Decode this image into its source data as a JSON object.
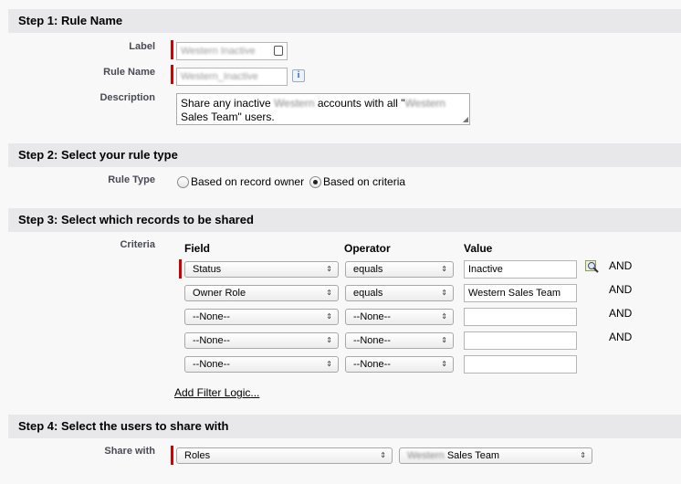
{
  "step1": {
    "header": "Step 1: Rule Name",
    "label_label": "Label",
    "label_value": "Western Inactive",
    "rule_name_label": "Rule Name",
    "rule_name_value": "Western_Inactive",
    "description_label": "Description",
    "description_line1_a": "Share any inactive ",
    "description_line1_blur": "Western",
    "description_line1_b": " accounts with all \"",
    "description_line1_blur2": "Western",
    "description_line2": "Sales Team\" users."
  },
  "step2": {
    "header": "Step 2: Select your rule type",
    "rule_type_label": "Rule Type",
    "option_owner": "Based on record owner",
    "option_criteria": "Based on criteria",
    "selected": "criteria"
  },
  "step3": {
    "header": "Step 3: Select which records to be shared",
    "criteria_label": "Criteria",
    "col_field": "Field",
    "col_operator": "Operator",
    "col_value": "Value",
    "rows": [
      {
        "field": "Status",
        "operator": "equals",
        "value": "Inactive",
        "conj": "AND"
      },
      {
        "field": "Owner Role",
        "operator": "equals",
        "value": "Western Sales Team",
        "conj": "AND"
      },
      {
        "field": "--None--",
        "operator": "--None--",
        "value": "",
        "conj": "AND"
      },
      {
        "field": "--None--",
        "operator": "--None--",
        "value": "",
        "conj": "AND"
      },
      {
        "field": "--None--",
        "operator": "--None--",
        "value": "",
        "conj": ""
      }
    ],
    "add_filter_logic": "Add Filter Logic..."
  },
  "step4": {
    "header": "Step 4: Select the users to share with",
    "share_with_label": "Share with",
    "share_type": "Roles",
    "share_target_blur": "Western",
    "share_target_rest": " Sales Team"
  },
  "colors": {
    "required_marker": "#cc0000",
    "header_bg": "#e8e8ea",
    "label_text": "#4a4a56"
  }
}
